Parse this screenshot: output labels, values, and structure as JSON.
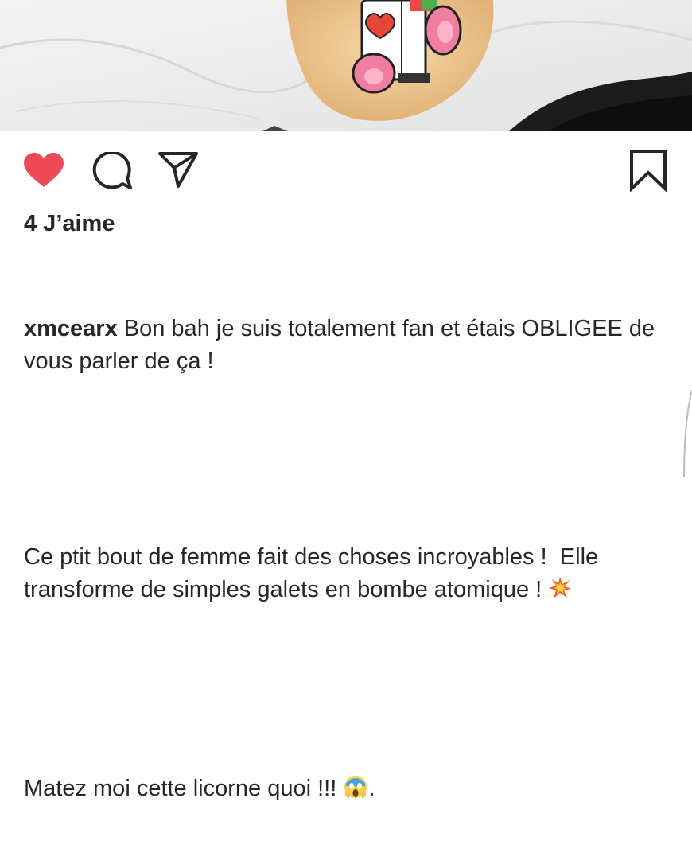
{
  "post": {
    "likes_text": "4 J’aime",
    "username": "xmcearx",
    "caption_line1": " Bon bah je suis totalement fan et étais OBLIGEE de vous parler de ça !",
    "caption_para2": "Ce ptit bout de femme fait des choses incroyables !  Elle transforme de simples galets en bombe atomique ! ",
    "caption_para3_prefix": "Matez moi cette licorne quoi !!! ",
    "caption_para3_suffix": "."
  },
  "icons": {
    "like": "heart-filled-icon",
    "comment": "comment-icon",
    "share": "send-icon",
    "save": "bookmark-icon",
    "emoji_boom": "collision-emoji",
    "emoji_scream": "face-screaming-emoji"
  },
  "colors": {
    "like_red": "#ed4956",
    "text": "#262626"
  }
}
